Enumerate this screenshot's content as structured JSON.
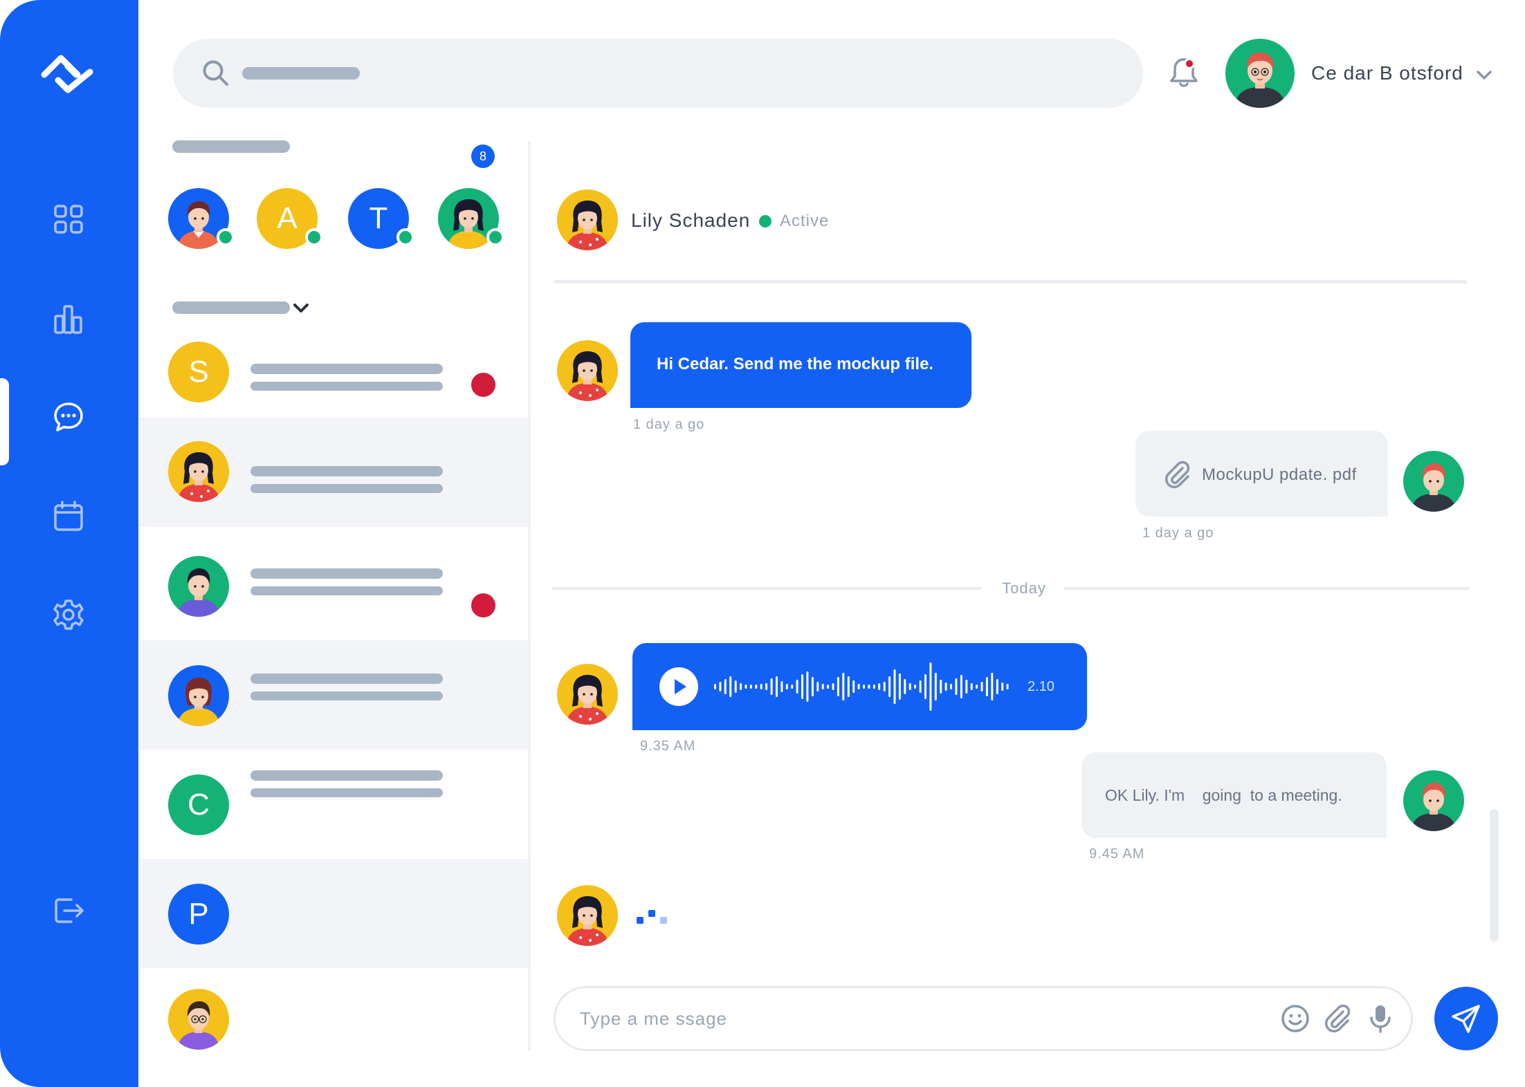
{
  "colors": {
    "accent": "#1360f5",
    "online": "#14b277",
    "unread": "#d31c39",
    "panel_bg": "#eff2f5"
  },
  "sidebar": {
    "logo": "app-logo",
    "items": [
      {
        "icon": "dashboard-grid-icon",
        "active": false
      },
      {
        "icon": "bar-chart-icon",
        "active": false
      },
      {
        "icon": "chat-bubble-icon",
        "active": true
      },
      {
        "icon": "calendar-icon",
        "active": false
      },
      {
        "icon": "settings-gear-icon",
        "active": false
      }
    ],
    "logout_icon": "logout-icon"
  },
  "header": {
    "search_icon": "search-icon",
    "notification_icon": "bell-icon",
    "has_notification": true,
    "user_name": "Ce dar B otsford"
  },
  "contacts": {
    "online_count": "8",
    "online": [
      {
        "initial": "",
        "bg": "#1360f5"
      },
      {
        "initial": "A",
        "bg": "#f5c01a"
      },
      {
        "initial": "T",
        "bg": "#1360f5"
      },
      {
        "initial": "",
        "bg": "#14b277"
      }
    ],
    "conversations": [
      {
        "initial": "S",
        "bg": "#f5c01a",
        "unread": true
      },
      {
        "initial": "",
        "bg": "#f5c01a",
        "unread": false
      },
      {
        "initial": "",
        "bg": "#14b277",
        "unread": true
      },
      {
        "initial": "",
        "bg": "#1360f5",
        "unread": false
      },
      {
        "initial": "C",
        "bg": "#14b277",
        "unread": false
      },
      {
        "initial": "P",
        "bg": "#1360f5",
        "unread": false
      },
      {
        "initial": "",
        "bg": "#f5c01a",
        "unread": false
      }
    ]
  },
  "chat": {
    "contact_name": "Lily  Schaden",
    "status": "Active",
    "messages": {
      "m1_text": "Hi Cedar. Send me the mockup file.",
      "m1_time": "1 day a go",
      "m2_file": "MockupU pdate. pdf",
      "m2_time": "1 day a go",
      "day_separator": "Today",
      "m3_duration": "2.10",
      "m3_time": "9.35  AM",
      "m4_text": "OK Lily. I'm    going  to a meeting.",
      "m4_time": "9.45  AM"
    },
    "typing_indicator": true
  },
  "composer": {
    "placeholder": "Type a me    ssage",
    "emoji_icon": "emoji-icon",
    "attach_icon": "paperclip-icon",
    "mic_icon": "microphone-icon",
    "send_icon": "send-icon"
  }
}
